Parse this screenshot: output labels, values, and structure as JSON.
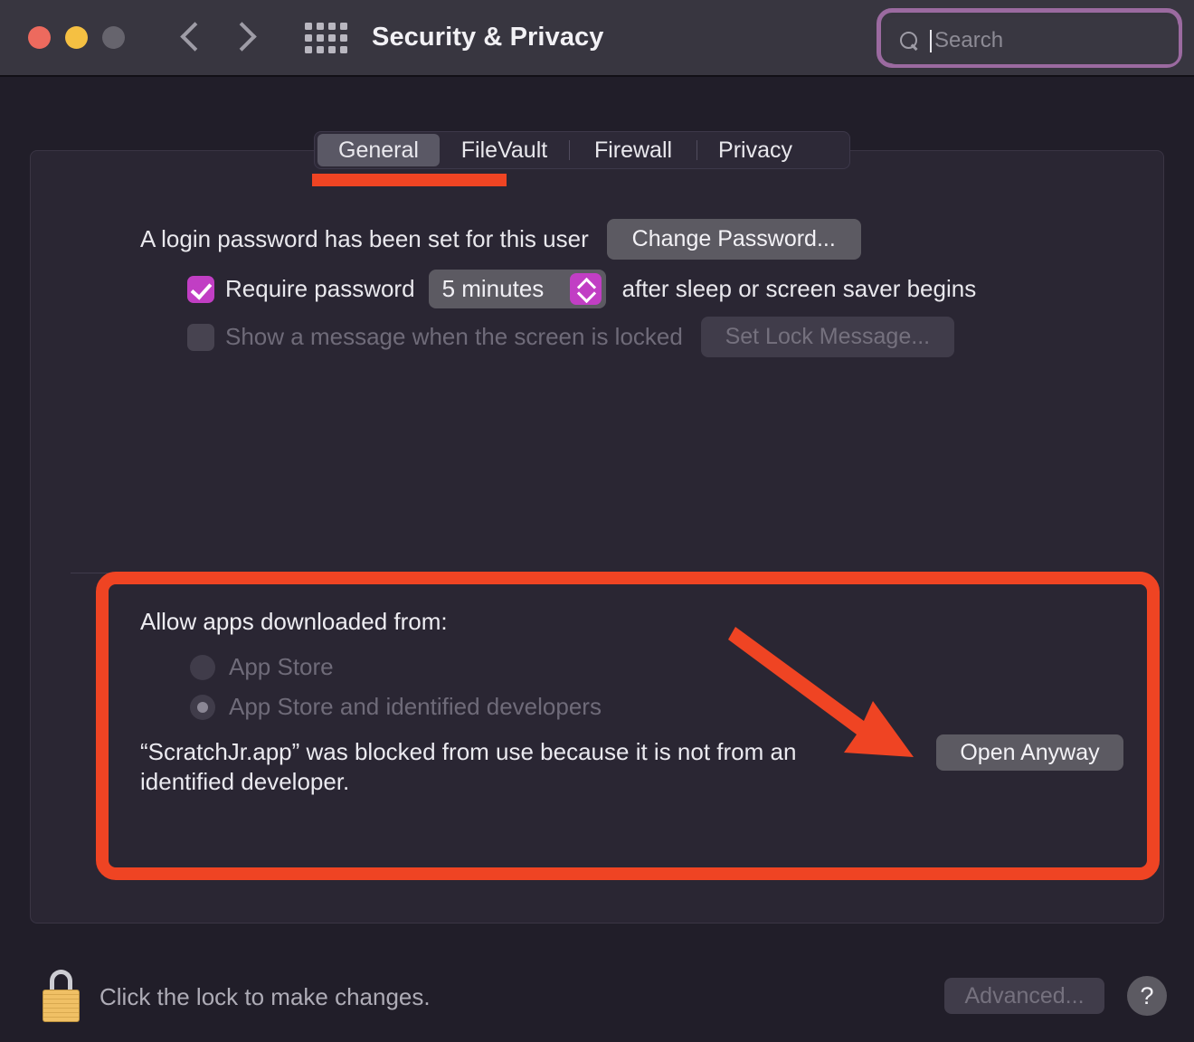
{
  "window": {
    "title": "Security & Privacy",
    "traffic_lights": [
      "close",
      "minimize",
      "zoom"
    ],
    "colors": {
      "accent_purple": "#c13ec4",
      "annotation_red": "#ef4423",
      "search_focus_ring": "#9b6aa0",
      "window_bg": "#211e29",
      "panel_bg": "#2a2633",
      "toolbar_bg": "#383640",
      "button_bg": "#5c5a62",
      "lock_gold": "#f0c065"
    }
  },
  "toolbar": {
    "back_icon": "chevron-left-icon",
    "forward_icon": "chevron-right-icon",
    "grid_icon": "grid-view-icon",
    "search": {
      "icon": "search-icon",
      "placeholder": "Search",
      "value": "",
      "focused": true
    }
  },
  "tabs": [
    {
      "label": "General",
      "selected": true
    },
    {
      "label": "FileVault",
      "selected": false
    },
    {
      "label": "Firewall",
      "selected": false
    },
    {
      "label": "Privacy",
      "selected": false
    }
  ],
  "general": {
    "password_status": "A login password has been set for this user",
    "change_password_button": "Change Password...",
    "require_password": {
      "checked": true,
      "label": "Require password",
      "interval": "5 minutes",
      "suffix": "after sleep or screen saver begins"
    },
    "lock_message": {
      "checked": false,
      "enabled": false,
      "label": "Show a message when the screen is locked",
      "button": "Set Lock Message..."
    }
  },
  "allow_apps": {
    "title": "Allow apps downloaded from:",
    "options": [
      {
        "label": "App Store",
        "selected": false,
        "enabled": false
      },
      {
        "label": "App Store and identified developers",
        "selected": true,
        "enabled": false
      }
    ],
    "blocked_message": "“ScratchJr.app” was blocked from use because it is not from an identified developer.",
    "open_anyway_button": "Open Anyway"
  },
  "footer": {
    "lock_icon": "lock-closed-icon",
    "lock_text": "Click the lock to make changes.",
    "advanced_button": "Advanced...",
    "help_button": "?"
  }
}
